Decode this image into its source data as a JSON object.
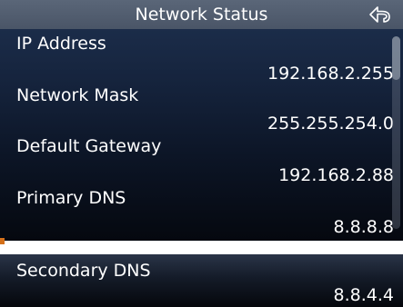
{
  "header": {
    "title": "Network Status",
    "back_icon": "back-arrow-icon"
  },
  "rows": [
    {
      "label": "IP Address",
      "value": "192.168.2.255"
    },
    {
      "label": "Network Mask",
      "value": "255.255.254.0"
    },
    {
      "label": "Default Gateway",
      "value": "192.168.2.88"
    },
    {
      "label": "Primary DNS",
      "value": "8.8.8.8"
    }
  ],
  "bottom": {
    "label": "Secondary DNS",
    "value": "8.8.4.4"
  },
  "colors": {
    "header_bg": "#4f5b6d",
    "screen_top": "#1e3150",
    "screen_bottom": "#05080f",
    "text": "#ffffff",
    "accent": "#d4701a"
  }
}
